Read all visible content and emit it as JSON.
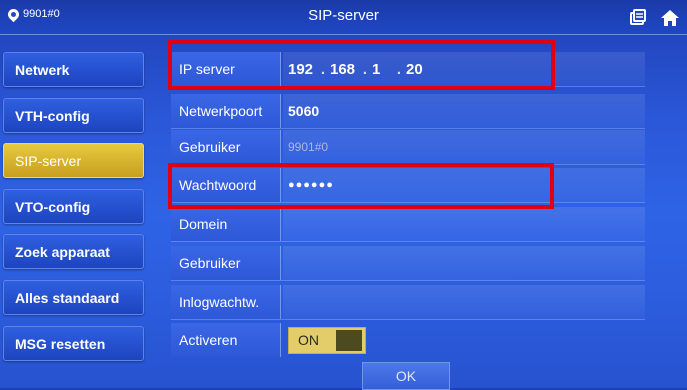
{
  "header": {
    "device_id": "9901#0",
    "title": "SIP-server",
    "icons": [
      "location-pin-icon",
      "layers-icon",
      "home-icon"
    ]
  },
  "sidebar": {
    "items": [
      {
        "label": "Netwerk",
        "active": false
      },
      {
        "label": "VTH-config",
        "active": false
      },
      {
        "label": "SIP-server",
        "active": true
      },
      {
        "label": "VTO-config",
        "active": false
      },
      {
        "label": "Zoek apparaat",
        "active": false
      },
      {
        "label": "Alles standaard",
        "active": false
      },
      {
        "label": "MSG resetten",
        "active": false
      }
    ]
  },
  "form": {
    "ip_label": "IP server",
    "ip": {
      "o1": "192",
      "o2": "168",
      "o3": "1",
      "o4": "20"
    },
    "port_label": "Netwerkpoort",
    "port_value": "5060",
    "user_label": "Gebruiker",
    "user_value": "9901#0",
    "password_label": "Wachtwoord",
    "password_value": "●●●●●●",
    "domain_label": "Domein",
    "domain_value": "",
    "user2_label": "Gebruiker",
    "user2_value": "",
    "login_pw_label": "Inlogwachtw.",
    "login_pw_value": "",
    "enable_label": "Activeren",
    "enable_value": "ON"
  },
  "actions": {
    "ok_label": "OK"
  },
  "colors": {
    "accent_yellow": "#e3c84c",
    "background_blue": "#2b5cdc",
    "highlight_red": "#e00012"
  }
}
